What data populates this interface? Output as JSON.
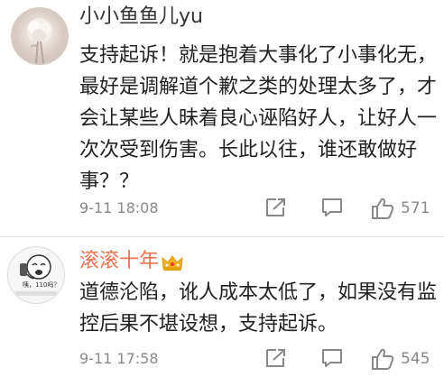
{
  "comments": [
    {
      "username": "小小鱼鱼儿yu",
      "text": "支持起诉！就是抱着大事化了小事化无，最好是调解道个歉之类的处理太多了，才会让某些人昧着良心诬陷好人，让好人一次次受到伤害。长此以往，谁还敢做好事？？",
      "time": "9-11 18:08",
      "likes": "571"
    },
    {
      "username": "滚滚十年",
      "text": "道德沦陷，讹人成本太低了，如果没有监控后果不堪设想，支持起诉。",
      "time": "9-11 17:58",
      "likes": "545",
      "avatar_caption": "咦，110吗？"
    }
  ],
  "colors": {
    "username_highlight": "#eb7350",
    "meta_gray": "#888888",
    "crown_gold": "#f2b21b"
  },
  "icons": [
    "share-icon",
    "comment-icon",
    "like-icon",
    "crown-badge-icon"
  ]
}
